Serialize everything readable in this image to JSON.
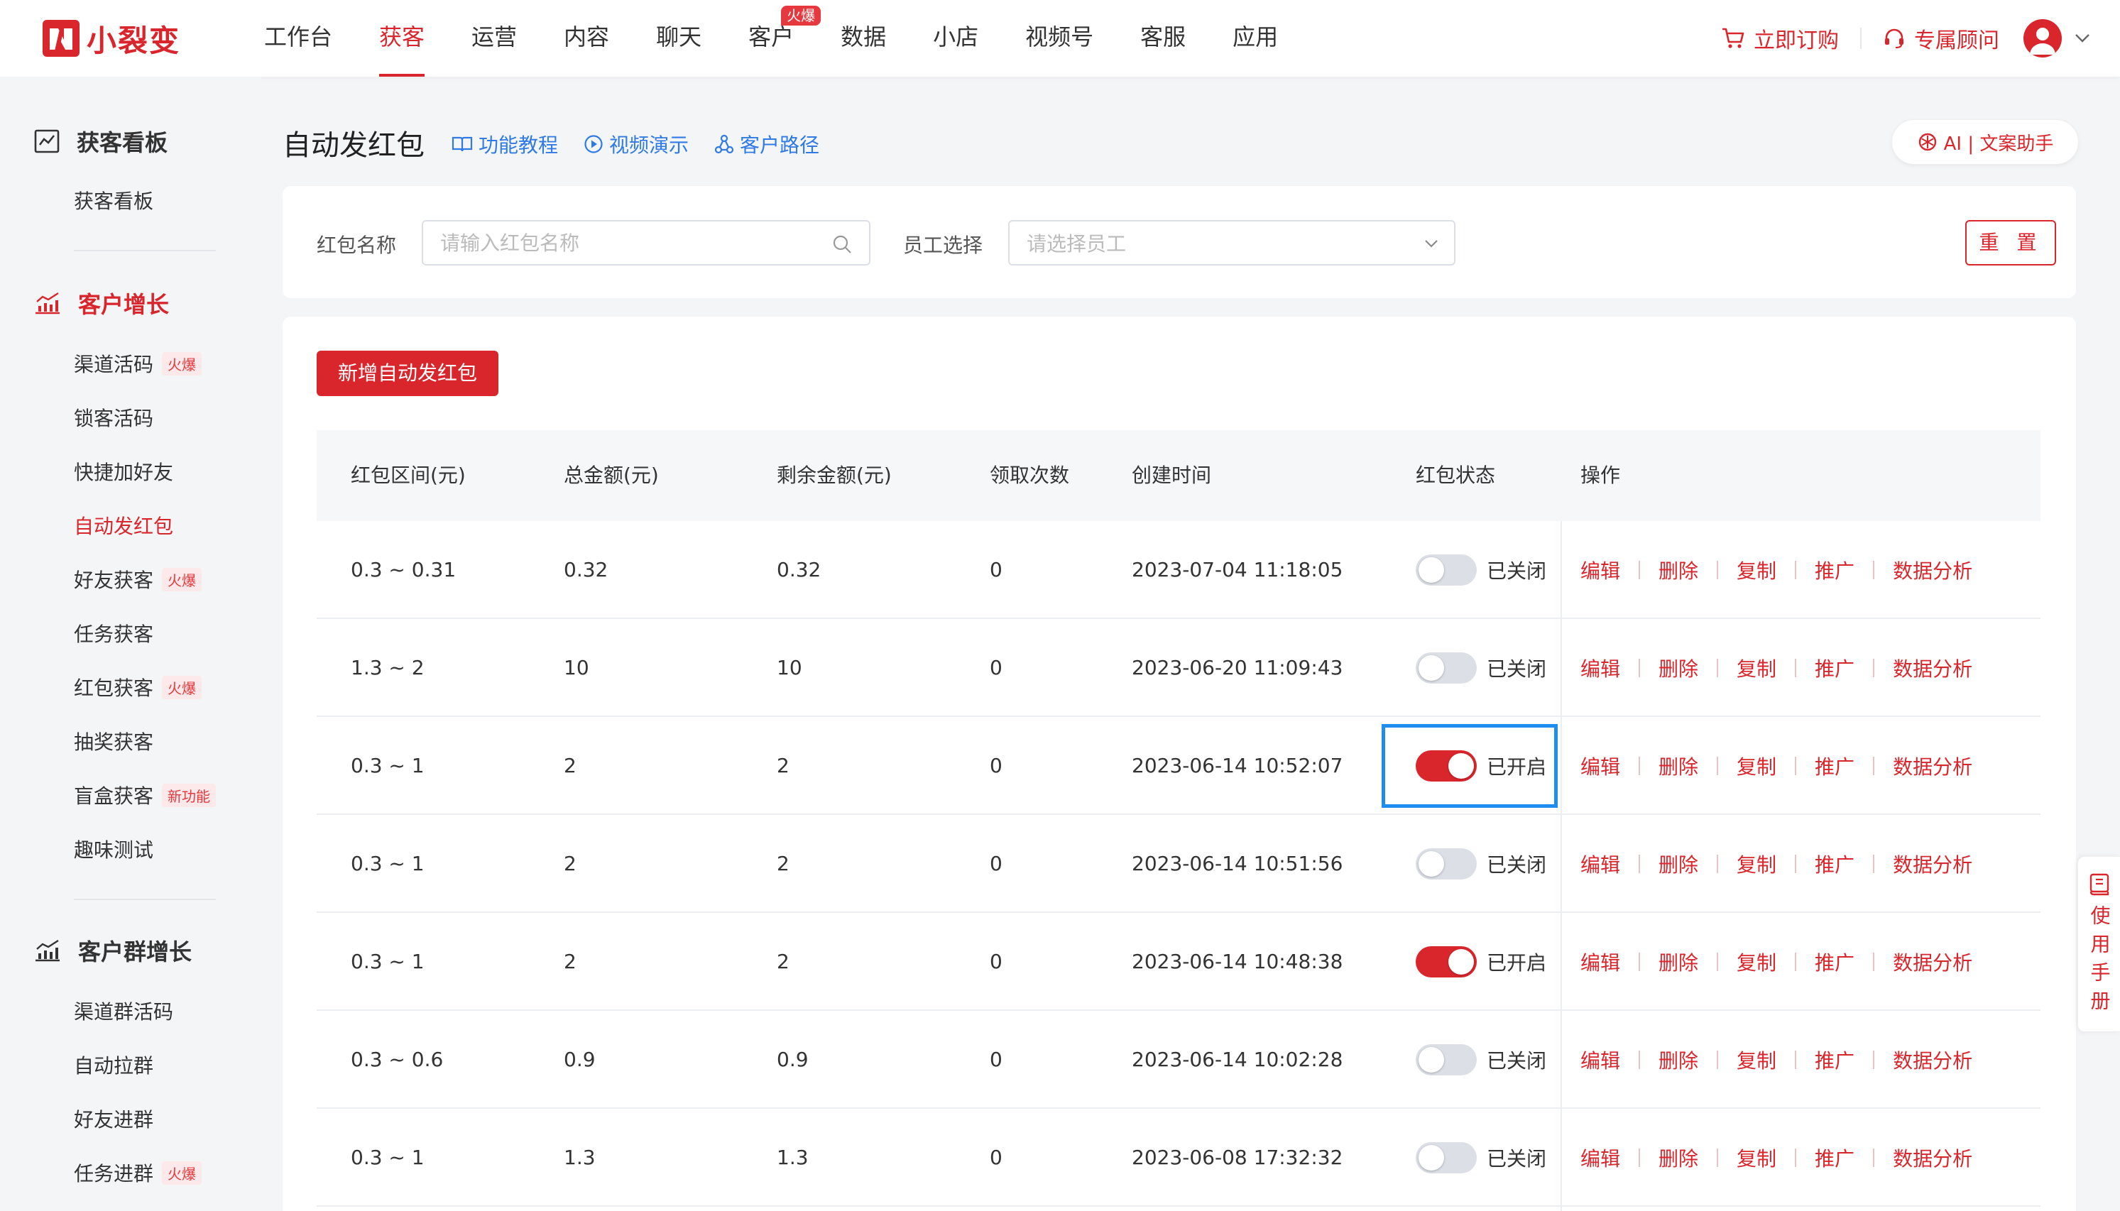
{
  "brand": {
    "name": "小裂变",
    "color": "#d9262c"
  },
  "nav": {
    "items": [
      {
        "label": "工作台"
      },
      {
        "label": "获客",
        "active": true
      },
      {
        "label": "运营"
      },
      {
        "label": "内容"
      },
      {
        "label": "聊天"
      },
      {
        "label": "客户",
        "badge": "火爆"
      },
      {
        "label": "数据"
      },
      {
        "label": "小店"
      },
      {
        "label": "视频号"
      },
      {
        "label": "客服"
      },
      {
        "label": "应用"
      }
    ],
    "order_label": "立即订购",
    "advisor_label": "专属顾问"
  },
  "sidebar": {
    "groups": [
      {
        "title": "获客看板",
        "icon": "dashboard-icon",
        "items": [
          {
            "label": "获客看板"
          }
        ]
      },
      {
        "title": "客户增长",
        "icon": "growth-chart-icon",
        "items": [
          {
            "label": "渠道活码",
            "badge": "火爆"
          },
          {
            "label": "锁客活码"
          },
          {
            "label": "快捷加好友"
          },
          {
            "label": "自动发红包",
            "active": true
          },
          {
            "label": "好友获客",
            "badge": "火爆"
          },
          {
            "label": "任务获客"
          },
          {
            "label": "红包获客",
            "badge": "火爆"
          },
          {
            "label": "抽奖获客"
          },
          {
            "label": "盲盒获客",
            "badge": "新功能"
          },
          {
            "label": "趣味测试"
          }
        ]
      },
      {
        "title": "客户群增长",
        "icon": "group-growth-icon",
        "items": [
          {
            "label": "渠道群活码"
          },
          {
            "label": "自动拉群"
          },
          {
            "label": "好友进群"
          },
          {
            "label": "任务进群",
            "badge": "火爆"
          }
        ]
      }
    ]
  },
  "page": {
    "title": "自动发红包",
    "links": [
      "功能教程",
      "视频演示",
      "客户路径"
    ],
    "ai_button": "AI | 文案助手"
  },
  "filter": {
    "name_label": "红包名称",
    "name_placeholder": "请输入红包名称",
    "staff_label": "员工选择",
    "staff_placeholder": "请选择员工",
    "reset_label": "重 置"
  },
  "table": {
    "add_button": "新增自动发红包",
    "columns": [
      "红包区间(元)",
      "总金额(元)",
      "剩余金额(元)",
      "领取次数",
      "创建时间",
      "红包状态",
      "操作"
    ],
    "actions": [
      "编辑",
      "删除",
      "复制",
      "推广",
      "数据分析"
    ],
    "rows": [
      {
        "range": "0.3 ~ 0.31",
        "total": "0.32",
        "remaining": "0.32",
        "claims": "0",
        "created": "2023-07-04 11:18:05",
        "status_on": false,
        "status_text": "已关闭"
      },
      {
        "range": "1.3 ~ 2",
        "total": "10",
        "remaining": "10",
        "claims": "0",
        "created": "2023-06-20 11:09:43",
        "status_on": false,
        "status_text": "已关闭"
      },
      {
        "range": "0.3 ~ 1",
        "total": "2",
        "remaining": "2",
        "claims": "0",
        "created": "2023-06-14 10:52:07",
        "status_on": true,
        "status_text": "已开启",
        "focused": true
      },
      {
        "range": "0.3 ~ 1",
        "total": "2",
        "remaining": "2",
        "claims": "0",
        "created": "2023-06-14 10:51:56",
        "status_on": false,
        "status_text": "已关闭"
      },
      {
        "range": "0.3 ~ 1",
        "total": "2",
        "remaining": "2",
        "claims": "0",
        "created": "2023-06-14 10:48:38",
        "status_on": true,
        "status_text": "已开启"
      },
      {
        "range": "0.3 ~ 0.6",
        "total": "0.9",
        "remaining": "0.9",
        "claims": "0",
        "created": "2023-06-14 10:02:28",
        "status_on": false,
        "status_text": "已关闭"
      },
      {
        "range": "0.3 ~ 1",
        "total": "1.3",
        "remaining": "1.3",
        "claims": "0",
        "created": "2023-06-08 17:32:32",
        "status_on": false,
        "status_text": "已关闭"
      }
    ]
  },
  "manual": {
    "label": "使用手册"
  }
}
